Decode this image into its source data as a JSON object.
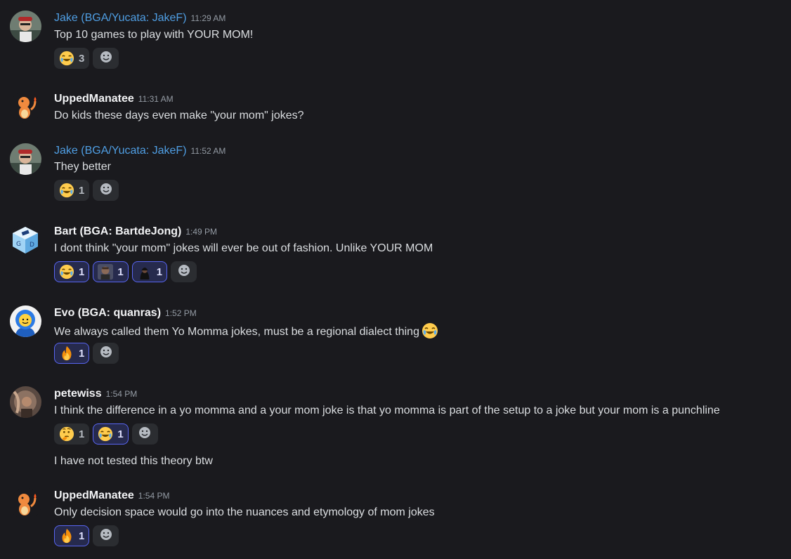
{
  "messages": [
    {
      "author": "Jake (BGA/Yucata: JakeF)",
      "time": "11:29 AM",
      "lines": [
        "Top 10 games to play with YOUR MOM!"
      ],
      "reactions": [
        {
          "emoji": "joy",
          "count": "3"
        }
      ]
    },
    {
      "author": "UppedManatee",
      "time": "11:31 AM",
      "lines": [
        "Do kids these days even make \"your mom\" jokes?"
      ]
    },
    {
      "author": "Jake (BGA/Yucata: JakeF)",
      "time": "11:52 AM",
      "lines": [
        "They better"
      ],
      "reactions": [
        {
          "emoji": "joy",
          "count": "1"
        }
      ]
    },
    {
      "author": "Bart (BGA: BartdeJong)",
      "time": "1:49 PM",
      "lines": [
        "I dont think \"your mom\" jokes will ever be out of fashion. Unlike YOUR MOM"
      ],
      "reactions": [
        {
          "emoji": "joy",
          "count": "1"
        },
        {
          "emoji": "custom-face-1",
          "count": "1"
        },
        {
          "emoji": "custom-face-2",
          "count": "1"
        }
      ]
    },
    {
      "author": "Evo (BGA: quanras)",
      "time": "1:52 PM",
      "lines": [
        "We always called them Yo Momma jokes, must be a regional dialect thing"
      ],
      "reactions": [
        {
          "emoji": "fire",
          "count": "1"
        }
      ]
    },
    {
      "author": "petewiss",
      "time": "1:54 PM",
      "lines": [
        "I think the difference in a yo momma and a your mom joke is that yo momma is part of the setup to a joke but your mom is a punchline",
        "I have not tested this theory btw"
      ],
      "reactions": [
        {
          "emoji": "thinking",
          "count": "1"
        },
        {
          "emoji": "joy",
          "count": "1"
        }
      ]
    },
    {
      "author": "UppedManatee",
      "time": "1:54 PM",
      "lines": [
        "Only decision space would go into the nuances and etymology of mom jokes"
      ],
      "reactions": [
        {
          "emoji": "fire",
          "count": "1"
        }
      ]
    }
  ],
  "colors": {
    "background": "#1a1a1e",
    "link_author": "#4f9ee3",
    "reaction_selected": "#5865f2"
  }
}
